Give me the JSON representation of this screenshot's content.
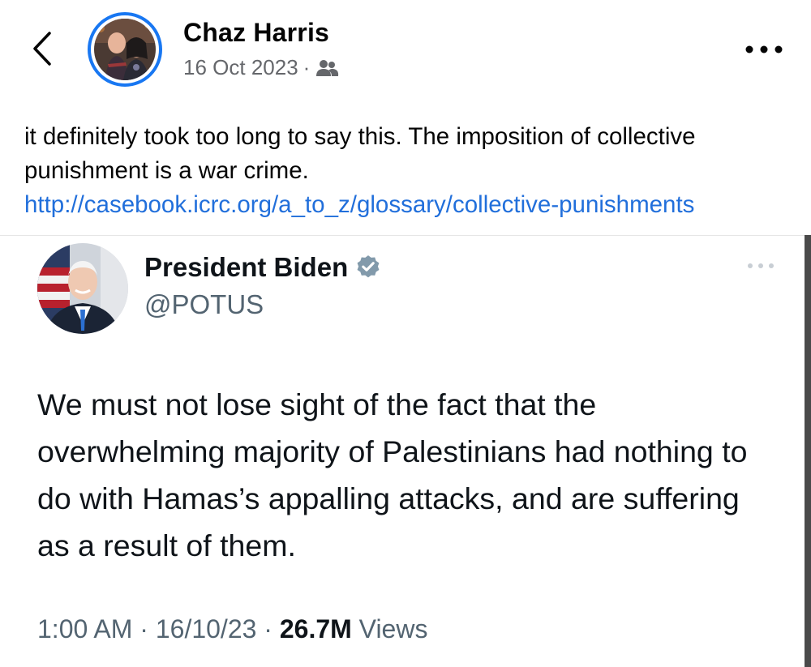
{
  "post": {
    "author_name": "Chaz Harris",
    "date": "16 Oct 2023",
    "separator": "·",
    "audience_icon": "friends-icon",
    "text": "it definitely took too long to say this. The imposition of collective punishment is a war crime. ",
    "link_text": "http://casebook.icrc.org/a_to_z/glossary/collective-punishments"
  },
  "tweet": {
    "name": "President Biden",
    "handle": "@POTUS",
    "verified_icon": "verified-badge-icon",
    "text": "We must not lose sight of the fact that the overwhelming majority of Palestinians had nothing to do with Hamas’s appalling attacks, and are suffering as a result of them.",
    "time": "1:00 AM",
    "date": "16/10/23",
    "views_count": "26.7M",
    "views_label": "Views",
    "separator": "·"
  },
  "colors": {
    "link": "#216fdb",
    "avatar_ring": "#1877f2",
    "meta_text": "#65676b",
    "tweet_secondary": "#536471",
    "verified_badge": "#829aab"
  }
}
